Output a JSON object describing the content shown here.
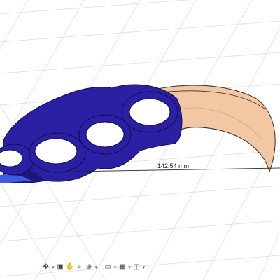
{
  "canvas": {
    "measurement_label": "142.54 mm"
  },
  "toolbar": {
    "items": [
      {
        "icon": "orbit-icon",
        "has_menu": true
      },
      {
        "icon": "look-at-icon",
        "has_menu": false
      },
      {
        "icon": "pan-hand-icon",
        "has_menu": false
      },
      {
        "icon": "zoom-icon",
        "has_menu": false
      },
      {
        "icon": "fit-icon",
        "has_menu": true
      },
      {
        "icon": "display-settings-icon",
        "has_menu": true
      },
      {
        "icon": "grid-snaps-icon",
        "has_menu": true
      },
      {
        "icon": "viewports-icon",
        "has_menu": true
      }
    ]
  },
  "colors": {
    "body_blue": "#2b1fa3",
    "body_blue_dark": "#1e1580",
    "blade_peach": "#f2c7a4",
    "grid_line": "#e2e2e2"
  }
}
